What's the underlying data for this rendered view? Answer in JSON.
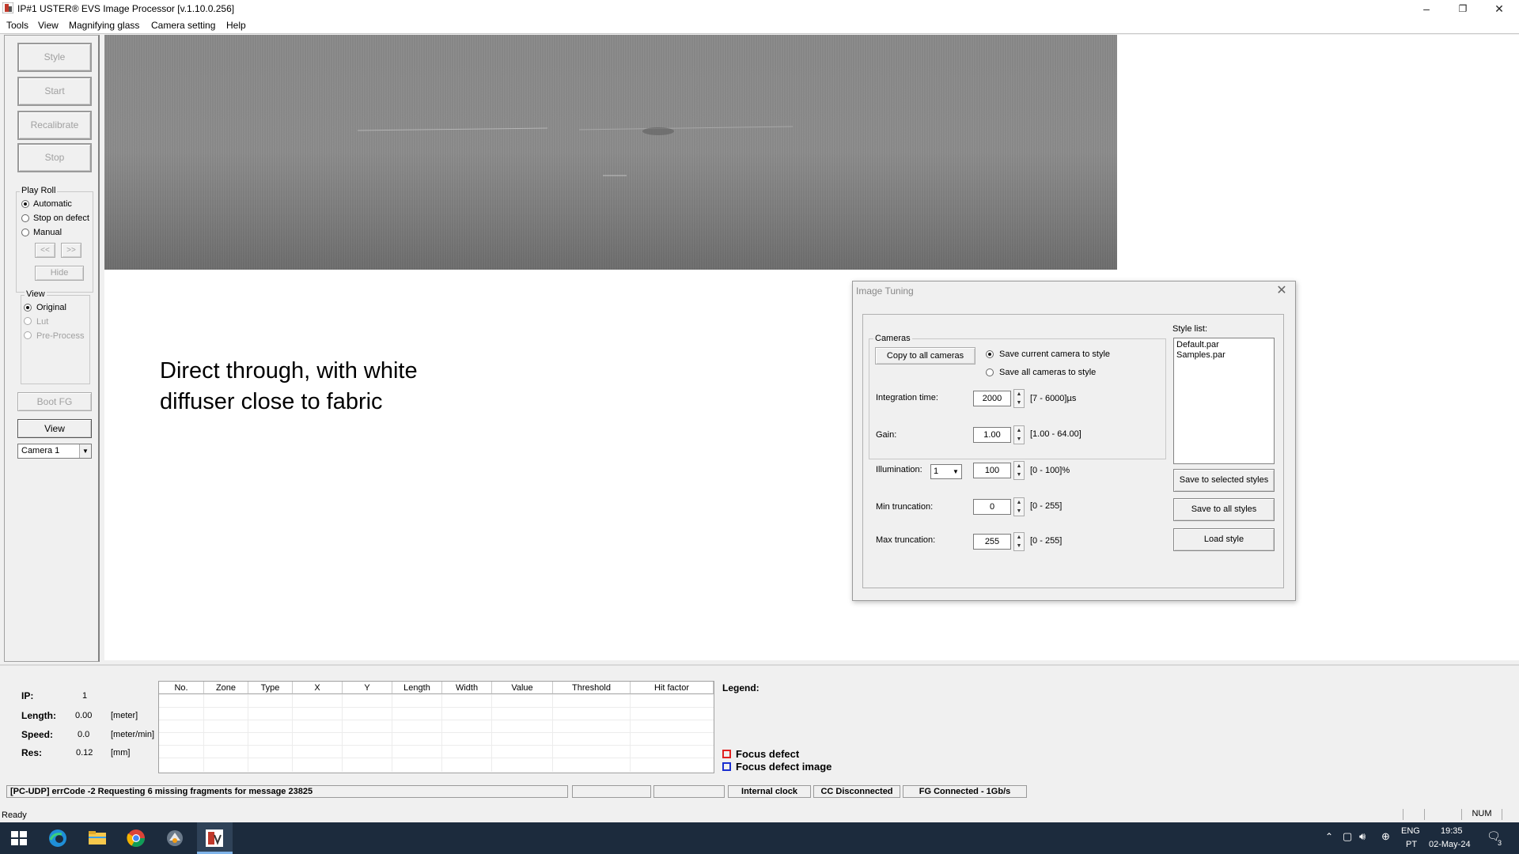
{
  "window": {
    "title": "IP#1  USTER® EVS Image Processor [v.1.10.0.256]",
    "controls": {
      "minimize": "–",
      "restore": "❐",
      "close": "✕"
    }
  },
  "menu": [
    "Tools",
    "View",
    "Magnifying glass",
    "Camera setting",
    "Help"
  ],
  "left_panel": {
    "buttons": {
      "style": "Style",
      "start": "Start",
      "recalibrate": "Recalibrate",
      "stop": "Stop"
    },
    "play_roll": {
      "label": "Play Roll",
      "options": [
        "Automatic",
        "Stop on defect",
        "Manual"
      ],
      "selected": "Automatic",
      "prev": "<<",
      "next": ">>",
      "hide": "Hide"
    },
    "view": {
      "label": "View",
      "options": [
        "Original",
        "Lut",
        "Pre-Process"
      ],
      "selected": "Original"
    },
    "boot_fg": "Boot FG",
    "view_button": "View",
    "camera_select": "Camera 1"
  },
  "annotation": "Direct through, with white diffuser close to fabric",
  "dialog": {
    "title": "Image Tuning",
    "close": "✕",
    "cameras_label": "Cameras",
    "copy_all": "Copy to all cameras",
    "save_current": "Save current camera to style",
    "save_all": "Save all cameras to style",
    "integration": {
      "label": "Integration time:",
      "value": "2000",
      "range": "[7 - 6000]µs"
    },
    "gain": {
      "label": "Gain:",
      "value": "1.00",
      "range": "[1.00 - 64.00]"
    },
    "illumination": {
      "label": "Illumination:",
      "channel": "1",
      "value": "100",
      "range": "[0 - 100]%"
    },
    "min_trunc": {
      "label": "Min truncation:",
      "value": "0",
      "range": "[0 - 255]"
    },
    "max_trunc": {
      "label": "Max truncation:",
      "value": "255",
      "range": "[0 - 255]"
    },
    "style_list_label": "Style list:",
    "style_list": [
      "Default.par",
      "Samples.par"
    ],
    "save_selected": "Save to selected styles",
    "save_all_styles": "Save to all styles",
    "load_style": "Load style"
  },
  "info": {
    "ip_label": "IP:",
    "ip_value": "1",
    "length_label": "Length:",
    "length_value": "0.00",
    "length_unit": "[meter]",
    "speed_label": "Speed:",
    "speed_value": "0.0",
    "speed_unit": "[meter/min]",
    "res_label": "Res:",
    "res_value": "0.12",
    "res_unit": "[mm]"
  },
  "defect_table": {
    "columns": [
      "No.",
      "Zone",
      "Type",
      "X",
      "Y",
      "Length",
      "Width",
      "Value",
      "Threshold",
      "Hit factor"
    ]
  },
  "legend": {
    "label": "Legend:",
    "items": [
      {
        "name": "Focus defect",
        "color": "#e02020"
      },
      {
        "name": "Focus defect image",
        "color": "#1a2fd0"
      }
    ]
  },
  "status": {
    "message": "[PC-UDP] errCode -2 Requesting 6 missing fragments for message 23825",
    "clock": "Internal clock",
    "cc": "CC Disconnected",
    "fg": "FG Connected - 1Gb/s",
    "ready": "Ready",
    "num": "NUM"
  },
  "taskbar": {
    "lang_top": "ENG",
    "lang_bottom": "PT",
    "time": "19:35",
    "date": "02-May-24",
    "notifications": "3"
  }
}
